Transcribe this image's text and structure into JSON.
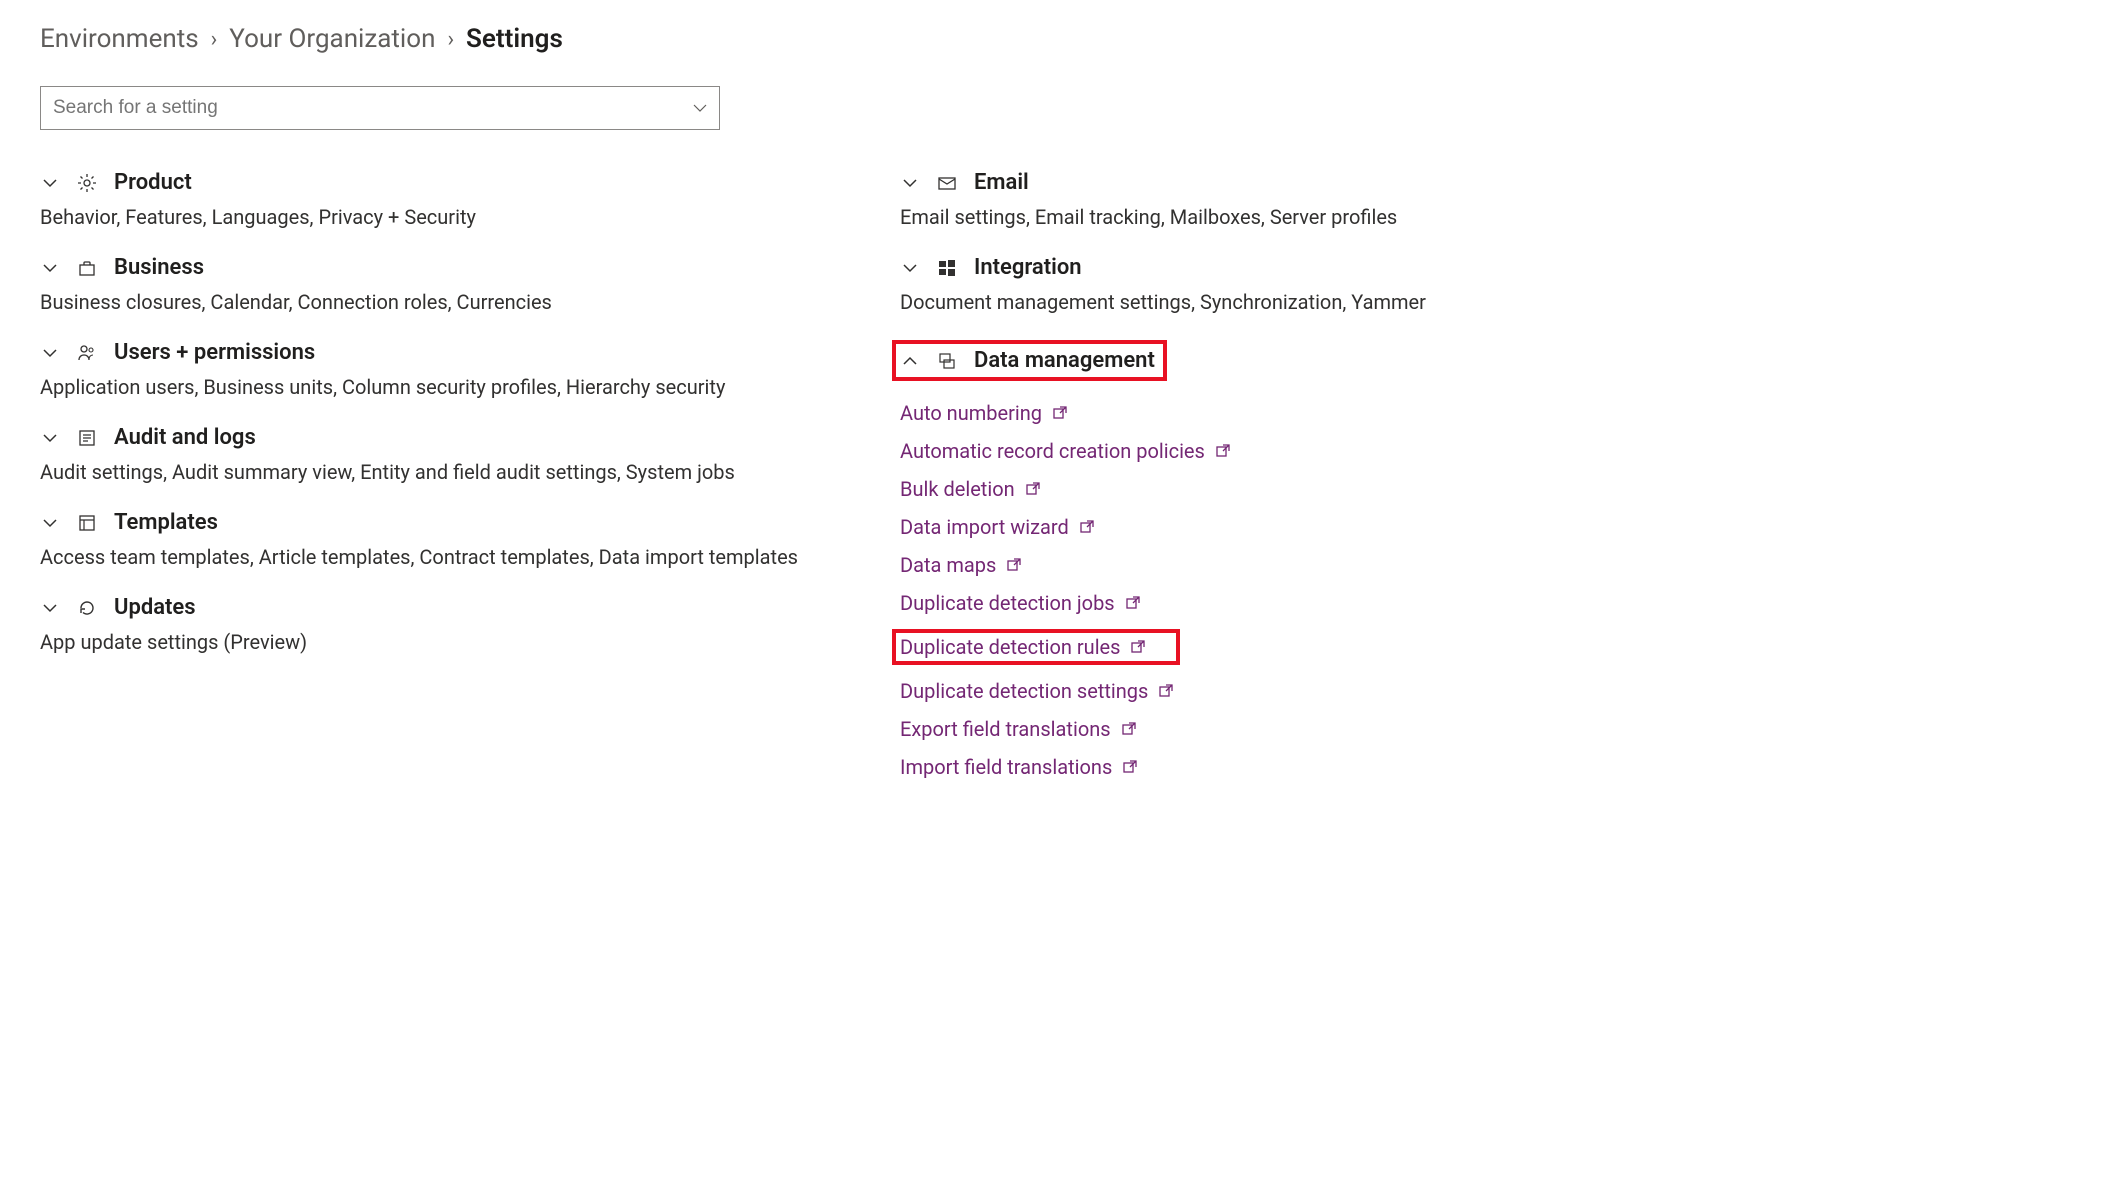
{
  "breadcrumb": {
    "item1": "Environments",
    "item2": "Your Organization",
    "current": "Settings"
  },
  "search": {
    "placeholder": "Search for a setting"
  },
  "left": {
    "product": {
      "title": "Product",
      "desc": "Behavior, Features, Languages, Privacy + Security"
    },
    "business": {
      "title": "Business",
      "desc": "Business closures, Calendar, Connection roles, Currencies"
    },
    "users": {
      "title": "Users + permissions",
      "desc": "Application users, Business units, Column security profiles, Hierarchy security"
    },
    "audit": {
      "title": "Audit and logs",
      "desc": "Audit settings, Audit summary view, Entity and field audit settings, System jobs"
    },
    "templates": {
      "title": "Templates",
      "desc": "Access team templates, Article templates, Contract templates, Data import templates"
    },
    "updates": {
      "title": "Updates",
      "desc": "App update settings (Preview)"
    }
  },
  "right": {
    "email": {
      "title": "Email",
      "desc": "Email settings, Email tracking, Mailboxes, Server profiles"
    },
    "integration": {
      "title": "Integration",
      "desc": "Document management settings, Synchronization, Yammer"
    },
    "datamgmt": {
      "title": "Data management",
      "links": [
        "Auto numbering",
        "Automatic record creation policies",
        "Bulk deletion",
        "Data import wizard",
        "Data maps",
        "Duplicate detection jobs",
        "Duplicate detection rules",
        "Duplicate detection settings",
        "Export field translations",
        "Import field translations"
      ]
    }
  }
}
